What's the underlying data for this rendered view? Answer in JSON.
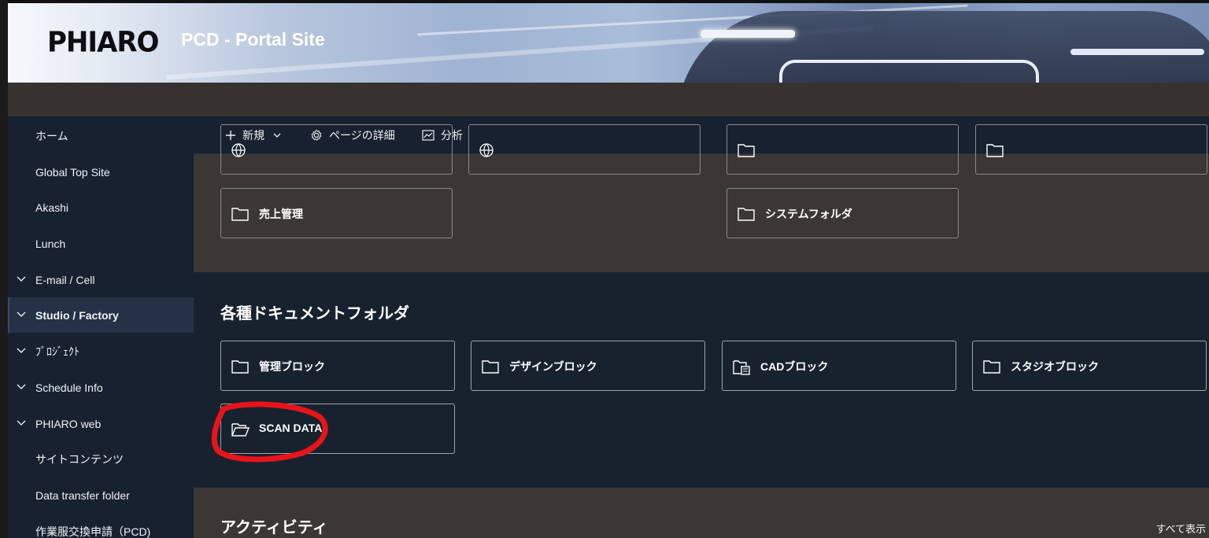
{
  "header": {
    "logo_text": "PHIARO",
    "site_title": "PCD - Portal Site"
  },
  "sidebar": {
    "items": [
      {
        "label": "ホーム",
        "expandable": false
      },
      {
        "label": "Global Top Site",
        "expandable": false
      },
      {
        "label": "Akashi",
        "expandable": false
      },
      {
        "label": "Lunch",
        "expandable": false
      },
      {
        "label": "E-mail / Cell",
        "expandable": true
      },
      {
        "label": "Studio / Factory",
        "expandable": true,
        "active": true
      },
      {
        "label": "ﾌﾟﾛｼﾞｪｸﾄ",
        "expandable": true
      },
      {
        "label": "Schedule Info",
        "expandable": true
      },
      {
        "label": "PHIARO web",
        "expandable": true
      },
      {
        "label": "サイトコンテンツ",
        "expandable": false
      },
      {
        "label": "Data transfer folder",
        "expandable": false
      },
      {
        "label": "作業服交換申請（PCD)",
        "expandable": false
      }
    ]
  },
  "command_bar": {
    "new_label": "新規",
    "page_details_label": "ページの詳細",
    "analytics_label": "分析"
  },
  "upper_section": {
    "tiles": [
      {
        "label": "売上管理",
        "icon": "folder-icon"
      },
      {
        "label": "システムフォルダ",
        "icon": "folder-icon"
      }
    ]
  },
  "docs_section": {
    "title": "各種ドキュメントフォルダ",
    "tiles": [
      {
        "label": "管理ブロック",
        "icon": "folder-icon"
      },
      {
        "label": "デザインブロック",
        "icon": "folder-icon"
      },
      {
        "label": "CADブロック",
        "icon": "shared-folder-icon"
      },
      {
        "label": "スタジオブロック",
        "icon": "folder-icon"
      },
      {
        "label": "SCAN DATA",
        "icon": "folder-open-icon"
      }
    ]
  },
  "activity_section": {
    "title": "アクティビティ",
    "see_all_label": "すべて表示"
  },
  "colors": {
    "nav_bg": "#17212f",
    "content_gray": "#3b3734",
    "annotation_red": "#e8141a"
  }
}
